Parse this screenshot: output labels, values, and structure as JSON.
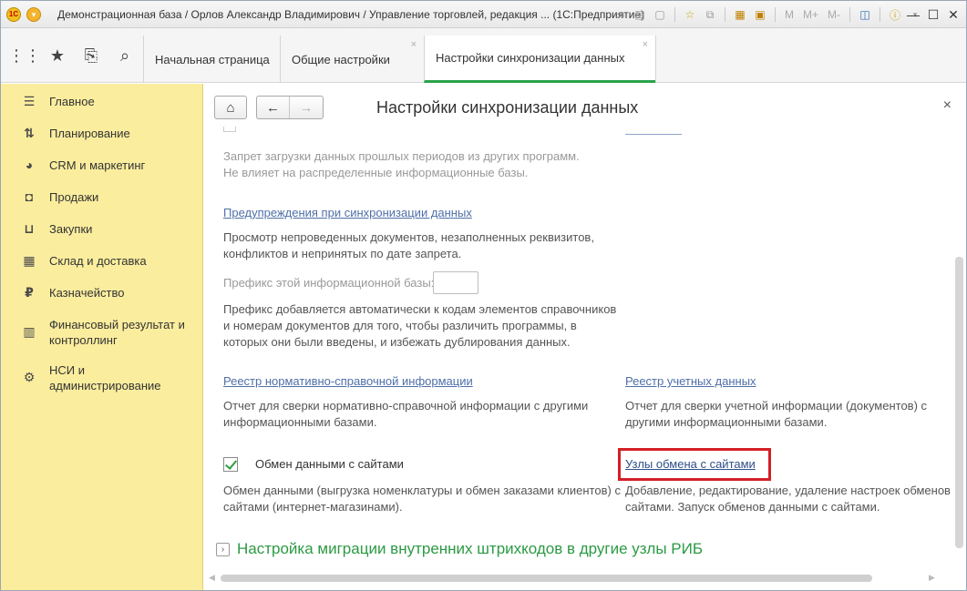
{
  "window": {
    "title": "Демонстрационная база / Орлов Александр Владимирович / Управление торговлей, редакция ... (1С:Предприятие)",
    "memory_buttons": [
      "M",
      "M+",
      "M-"
    ]
  },
  "tabs": [
    {
      "label": "Начальная страница",
      "closable": false,
      "active": false
    },
    {
      "label": "Общие настройки",
      "closable": true,
      "active": false
    },
    {
      "label": "Настройки синхронизации данных",
      "closable": true,
      "active": true
    }
  ],
  "sidebar": {
    "items": [
      {
        "label": "Главное",
        "icon": "menu-icon"
      },
      {
        "label": "Планирование",
        "icon": "planning-icon"
      },
      {
        "label": "CRM и маркетинг",
        "icon": "crm-icon"
      },
      {
        "label": "Продажи",
        "icon": "sales-bag-icon"
      },
      {
        "label": "Закупки",
        "icon": "cart-icon"
      },
      {
        "label": "Склад и доставка",
        "icon": "warehouse-icon"
      },
      {
        "label": "Казначейство",
        "icon": "ruble-icon"
      },
      {
        "label": "Финансовый результат и контроллинг",
        "icon": "chart-icon"
      },
      {
        "label": "НСИ и администрирование",
        "icon": "gear-icon"
      }
    ]
  },
  "form": {
    "title": "Настройки синхронизации данных",
    "ban_desc": "Запрет загрузки данных прошлых периодов из других программ. Не влияет на распределенные информационные базы.",
    "warnings_link": "Предупреждения при синхронизации данных",
    "warnings_desc": "Просмотр непроведенных документов, незаполненных реквизитов, конфликтов и непринятых по дате запрета.",
    "prefix_label": "Префикс этой информационной базы:",
    "prefix_value": "",
    "prefix_desc": "Префикс добавляется автоматически к кодам элементов справочников и номерам документов для того, чтобы различить программы, в которых они были введены, и избежать дублирования данных.",
    "registry_nsi_link": "Реестр нормативно-справочной информации",
    "registry_nsi_desc": "Отчет для сверки нормативно-справочной информации с другими информационными базами.",
    "registry_accounting_link": "Реестр учетных данных",
    "registry_accounting_desc": "Отчет для сверки учетной информации (документов) с другими информационными базами.",
    "site_exchange_label": "Обмен данными с сайтами",
    "site_exchange_checked": true,
    "site_exchange_desc": "Обмен данными (выгрузка номенклатуры и обмен заказами клиентов) с сайтами (интернет-магазинами).",
    "site_nodes_link": "Узлы обмена с сайтами",
    "site_nodes_desc": "Добавление, редактирование, удаление настроек обменов с сайтами. Запуск обменов данными с сайтами.",
    "migration_group": "Настройка миграции внутренних штрихкодов в другие узлы РИБ"
  },
  "colors": {
    "sidebar_bg": "#fbed9e",
    "link": "#4f6fa8",
    "group_title": "#2b9a43",
    "highlight_frame": "#d31f26"
  }
}
